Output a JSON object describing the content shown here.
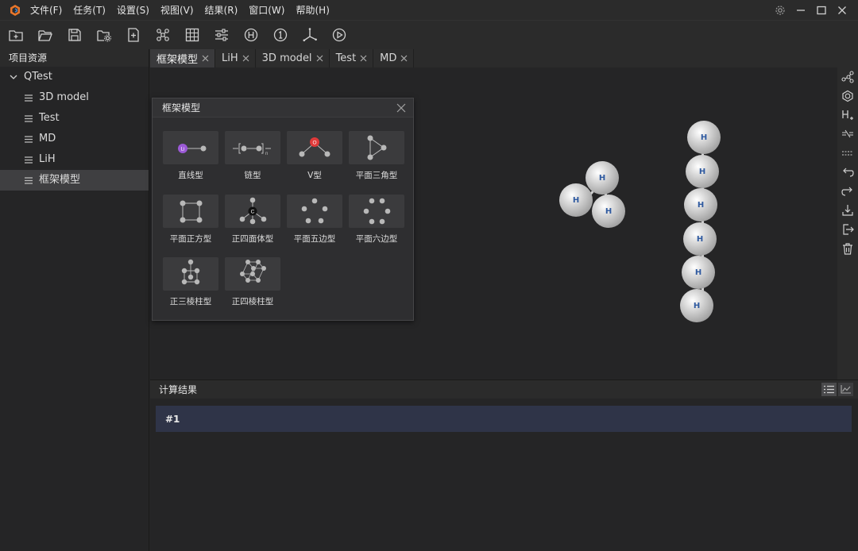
{
  "menubar": {
    "items": [
      "文件(F)",
      "任务(T)",
      "设置(S)",
      "视图(V)",
      "结果(R)",
      "窗口(W)",
      "帮助(H)"
    ],
    "logo_icon": "app-logo-icon",
    "controls": [
      "settings-icon",
      "minimize-icon",
      "maximize-icon",
      "close-icon"
    ]
  },
  "toolbar": {
    "tools": [
      "new-project-icon",
      "open-folder-icon",
      "save-icon",
      "project-settings-icon",
      "new-file-icon",
      "molecule-icon",
      "grid-icon",
      "sliders-icon",
      "h-circle-icon",
      "one-circle-icon",
      "axes-icon",
      "play-icon"
    ]
  },
  "sidebar": {
    "title": "项目资源",
    "root": "QTest",
    "items": [
      "3D model",
      "Test",
      "MD",
      "LiH",
      "框架模型"
    ],
    "selected_index": 4
  },
  "tabs": {
    "items": [
      "框架模型",
      "LiH",
      "3D model",
      "Test",
      "MD"
    ],
    "active_index": 0
  },
  "right_tools": [
    "bonds-icon",
    "ring-icon",
    "add-hydrogen-icon",
    "cut-bond-icon",
    "dashed-bond-icon",
    "undo-icon",
    "redo-icon",
    "import-icon",
    "export-icon",
    "delete-icon"
  ],
  "framework_panel": {
    "title": "框架模型",
    "items": [
      {
        "label": "直线型",
        "glyph": "Li"
      },
      {
        "label": "链型",
        "glyph": "n"
      },
      {
        "label": "V型",
        "glyph": "O"
      },
      {
        "label": "平面三角型",
        "glyph": ""
      },
      {
        "label": "平面正方型",
        "glyph": ""
      },
      {
        "label": "正四面体型",
        "glyph": "C"
      },
      {
        "label": "平面五边型",
        "glyph": ""
      },
      {
        "label": "平面六边型",
        "glyph": ""
      },
      {
        "label": "正三棱柱型",
        "glyph": ""
      },
      {
        "label": "正四棱柱型",
        "glyph": ""
      }
    ]
  },
  "viewport": {
    "atom_label": "H",
    "colors": {
      "atom": "#c8c8c8",
      "atom_text": "#2f5aa0",
      "li": "#9b59d6",
      "o": "#e03a3a",
      "c": "#111111"
    }
  },
  "results": {
    "title": "计算结果",
    "rows": [
      "#1"
    ],
    "buttons": [
      "list-icon",
      "chart-icon"
    ]
  }
}
